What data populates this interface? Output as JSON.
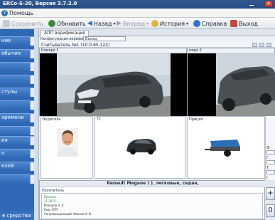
{
  "window": {
    "title": "ERCo-S-20, Версия 3.7.2.0"
  },
  "menu": {
    "help_label": "Помощь"
  },
  "toolbar": {
    "save_label": "Сохранить",
    "refresh_label": "Обновить",
    "back_label": "Назад",
    "forward_label": "Вперед",
    "history_label": "История",
    "help_label": "Справка",
    "exit_label": "Выход"
  },
  "sidebar": {
    "items": [
      {
        "label": "ние"
      },
      {
        "label": "обытия"
      },
      {
        "label": ""
      },
      {
        "label": ""
      },
      {
        "label": ""
      },
      {
        "label": "ступы"
      },
      {
        "label": ""
      },
      {
        "label": ""
      },
      {
        "label": "аремени"
      },
      {
        "label": ""
      },
      {
        "label": "ия"
      },
      {
        "label": "о"
      },
      {
        "label": "елей"
      },
      {
        "label": ""
      }
    ],
    "footer_label": "е средства"
  },
  "tabs": [
    {
      "label": "АПП верификация"
    }
  ],
  "config": {
    "label": "Конфигурация верификации:",
    "value": "Въезд"
  },
  "reader": {
    "label": "Считыватель №1 (10.0.65.122)"
  },
  "cameras": [
    {
      "label": "Камера 1"
    },
    {
      "label": "мера 2"
    }
  ],
  "cards": {
    "driver": "Водитель",
    "vehicle": "ТС",
    "trailer": "Прицеп"
  },
  "right_panel": {
    "fields": [
      "Ф",
      "Г",
      "Т",
      "(",
      "П"
    ]
  },
  "info": {
    "title": "Renault Megane (               ), легковые, седан,",
    "visitor_label": "Посетитель",
    "lines": [
      "Пропуск",
      "11.2015 - ...",
      "Макаров А. А.",
      "Код: АПП",
      "Сопровождающий: Иванов А. В."
    ]
  },
  "buttons": {
    "add": "+",
    "count": "0"
  }
}
